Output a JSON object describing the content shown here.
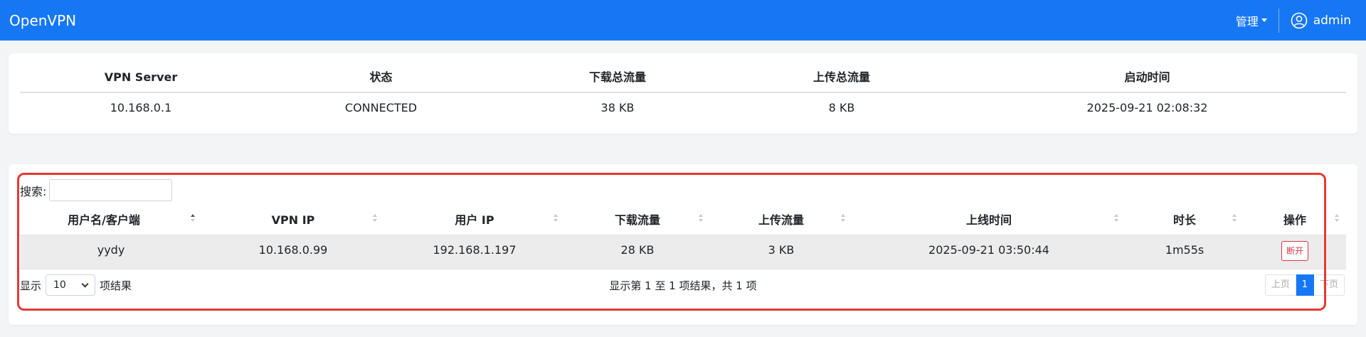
{
  "nav": {
    "brand": "OpenVPN",
    "manage_label": "管理",
    "user_label": "admin"
  },
  "summary": {
    "headers": [
      "VPN Server",
      "状态",
      "下载总流量",
      "上传总流量",
      "启动时间"
    ],
    "values": [
      "10.168.0.1",
      "CONNECTED",
      "38 KB",
      "8 KB",
      "2025-09-21 02:08:32"
    ]
  },
  "clients": {
    "search_label": "搜索:",
    "search_value": "",
    "columns": [
      "用户名/客户端",
      "VPN IP",
      "用户 IP",
      "下载流量",
      "上传流量",
      "上线时间",
      "时长",
      "操作"
    ],
    "rows": [
      {
        "username": "yydy",
        "vpn_ip": "10.168.0.99",
        "user_ip": "192.168.1.197",
        "download": "28 KB",
        "upload": "3 KB",
        "online_time": "2025-09-21 03:50:44",
        "duration": "1m55s",
        "action_label": "断开"
      }
    ],
    "show_label": "显示",
    "page_size": "10",
    "entries_label": "项结果",
    "info": "显示第 1 至 1 项结果，共 1 项",
    "prev_label": "上页",
    "current_page": "1",
    "next_label": "下页"
  },
  "colors": {
    "navbar": "#1677f5",
    "highlight_border": "#e53935",
    "danger": "#dc3545"
  }
}
